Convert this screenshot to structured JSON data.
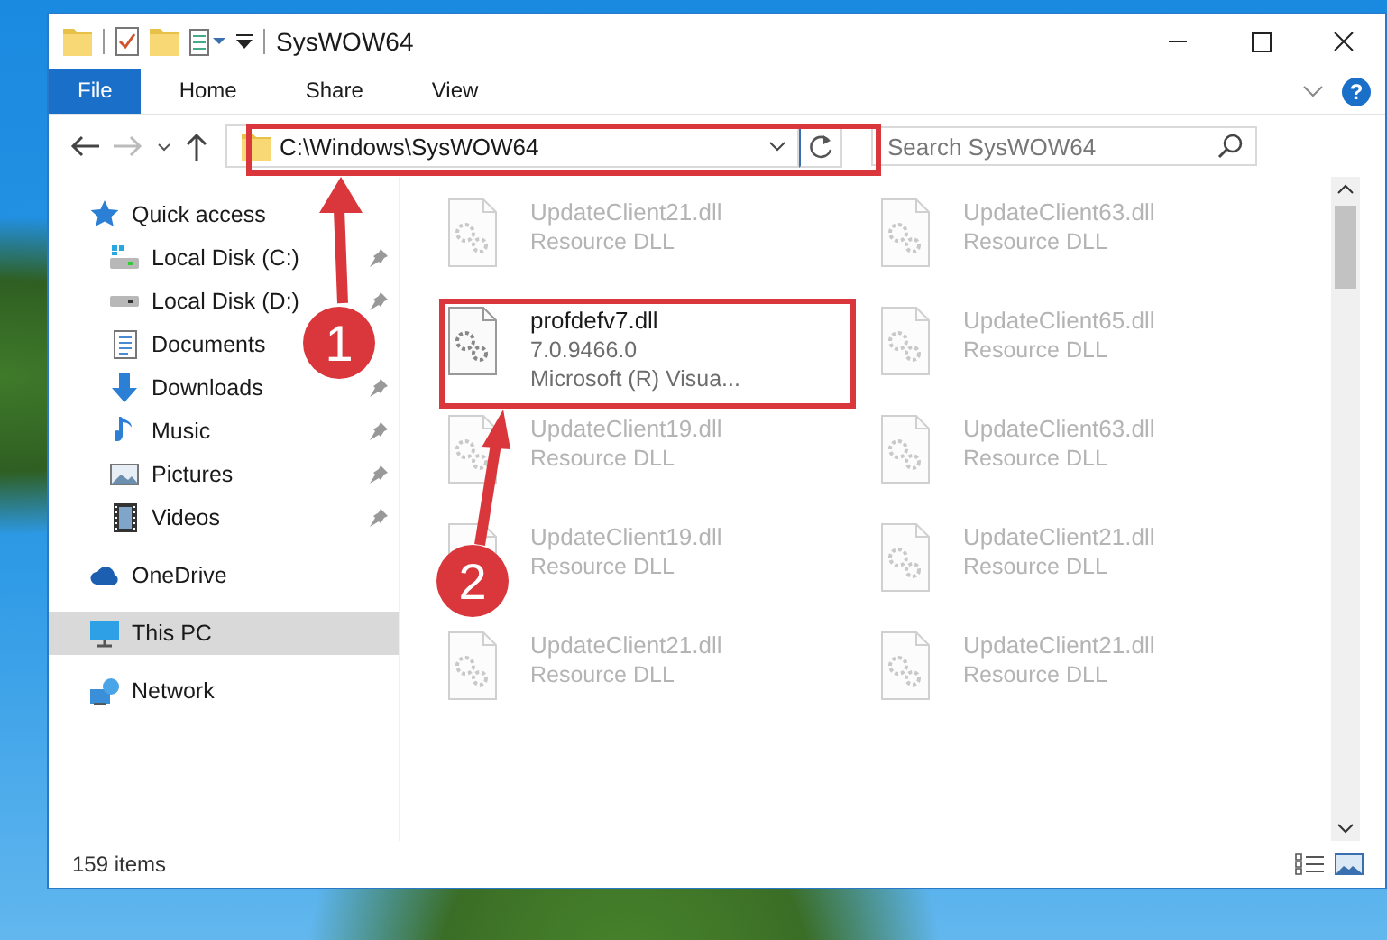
{
  "window": {
    "title": "SysWOW64"
  },
  "ribbon_tabs": [
    {
      "label": "File",
      "kind": "menu",
      "selected": false
    },
    {
      "label": "Home",
      "kind": "tab",
      "selected": false
    },
    {
      "label": "Share",
      "kind": "tab",
      "selected": false
    },
    {
      "label": "View",
      "kind": "tab",
      "selected": false
    }
  ],
  "help_button": {
    "label": "?"
  },
  "navigation": {
    "forward_disabled": true
  },
  "address_bar": {
    "value": "C:\\Windows\\SysWOW64"
  },
  "search": {
    "placeholder": "Search SysWOW64"
  },
  "sidebar": {
    "items": [
      {
        "label": "Quick access",
        "kind": "star",
        "selected": false,
        "children": [
          {
            "label": "Local Disk (C:)",
            "kind": "system-drive",
            "pinned": true,
            "selected": false
          },
          {
            "label": "Local Disk (D:)",
            "kind": "drive",
            "pinned": true,
            "selected": false
          },
          {
            "label": "Documents",
            "kind": "documents",
            "pinned": false,
            "selected": false
          },
          {
            "label": "Downloads",
            "kind": "downloads",
            "pinned": true,
            "selected": false
          },
          {
            "label": "Music",
            "kind": "music",
            "pinned": true,
            "selected": false
          },
          {
            "label": "Pictures",
            "kind": "pictures",
            "pinned": true,
            "selected": false
          },
          {
            "label": "Videos",
            "kind": "videos",
            "pinned": true,
            "selected": false
          }
        ]
      },
      {
        "label": "OneDrive",
        "kind": "cloud",
        "selected": false
      },
      {
        "label": "This PC",
        "kind": "pc",
        "selected": true
      },
      {
        "label": "Network",
        "kind": "network",
        "selected": false
      }
    ]
  },
  "files": [
    {
      "name": "UpdateClient21.dll",
      "details": [
        "Resource DLL"
      ],
      "kind": "faded"
    },
    {
      "name": "UpdateClient63.dll",
      "details": [
        "Resource DLL"
      ],
      "kind": "faded"
    },
    {
      "name": "profdefv7.dll",
      "details": [
        "7.0.9466.0",
        "Microsoft (R) Visua..."
      ],
      "kind": "normal"
    },
    {
      "name": "UpdateClient65.dll",
      "details": [
        "Resource DLL"
      ],
      "kind": "faded"
    },
    {
      "name": "UpdateClient19.dll",
      "details": [
        "Resource DLL"
      ],
      "kind": "faded"
    },
    {
      "name": "UpdateClient63.dll",
      "details": [
        "Resource DLL"
      ],
      "kind": "faded"
    },
    {
      "name": "UpdateClient19.dll",
      "details": [
        "Resource DLL"
      ],
      "kind": "faded"
    },
    {
      "name": "UpdateClient21.dll",
      "details": [
        "Resource DLL"
      ],
      "kind": "faded"
    },
    {
      "name": "UpdateClient21.dll",
      "details": [
        "Resource DLL"
      ],
      "kind": "faded"
    },
    {
      "name": "UpdateClient21.dll",
      "details": [
        "Resource DLL"
      ],
      "kind": "faded"
    }
  ],
  "status_bar": {
    "item_count": "159 items"
  },
  "annotations": [
    {
      "label": "1"
    },
    {
      "label": "2"
    }
  ]
}
